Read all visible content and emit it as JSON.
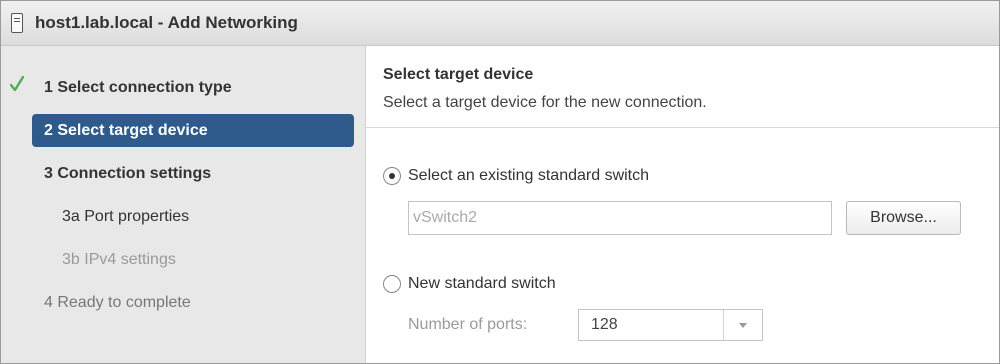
{
  "window": {
    "title": "host1.lab.local - Add Networking"
  },
  "sidebar": {
    "steps": [
      {
        "label": "1  Select connection type",
        "state": "completed"
      },
      {
        "label": "2  Select target device",
        "state": "active"
      },
      {
        "label": "3  Connection settings",
        "state": "pending"
      },
      {
        "label": "3a  Port properties",
        "state": "pending-sub"
      },
      {
        "label": "3b  IPv4 settings",
        "state": "disabled"
      },
      {
        "label": "4  Ready to complete",
        "state": "pending"
      }
    ]
  },
  "main": {
    "heading": "Select target device",
    "subheading": "Select a target device for the new connection.",
    "existing_switch": {
      "label": "Select an existing standard switch",
      "selected": true,
      "value": "vSwitch2",
      "browse_label": "Browse..."
    },
    "new_switch": {
      "label": "New standard switch",
      "selected": false,
      "ports_label": "Number of ports:",
      "ports_value": "128"
    }
  },
  "colors": {
    "active_step_bg": "#2e5b8b",
    "check": "#4caf50",
    "sidebar_bg": "#e8e8e8"
  },
  "icons": {
    "title": "host-icon",
    "completed_step": "checkmark-icon"
  }
}
